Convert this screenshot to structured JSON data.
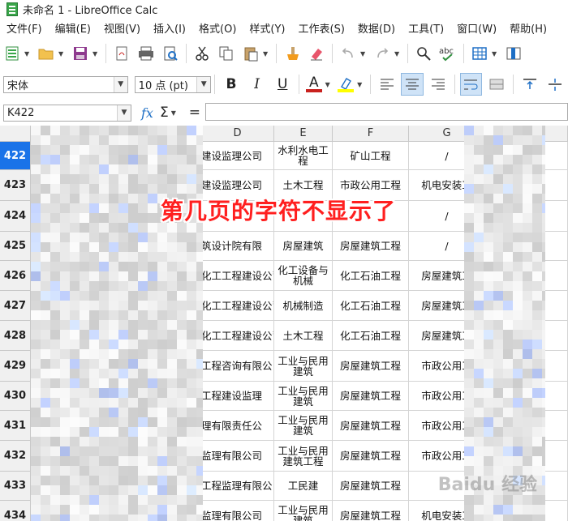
{
  "window": {
    "title": "未命名 1 - LibreOffice Calc"
  },
  "menu": [
    "文件(F)",
    "编辑(E)",
    "视图(V)",
    "插入(I)",
    "格式(O)",
    "样式(Y)",
    "工作表(S)",
    "数据(D)",
    "工具(T)",
    "窗口(W)",
    "帮助(H)"
  ],
  "toolbar": {
    "icons": [
      "new-spreadsheet-icon",
      "open-folder-icon",
      "save-icon",
      "export-pdf-icon",
      "print-icon",
      "print-preview-icon",
      "cut-icon",
      "copy-icon",
      "paste-icon",
      "clone-formatting-icon",
      "clear-formatting-icon",
      "undo-icon",
      "redo-icon",
      "find-replace-icon",
      "spelling-icon",
      "borders-icon",
      "column-icon"
    ]
  },
  "format_bar": {
    "font_name": "宋体",
    "font_size": "10 点 (pt)",
    "bold": "B",
    "italic": "I",
    "underline": "U",
    "font_color_letter": "A",
    "font_color": "#c9211e",
    "highlight_color": "#ffff00"
  },
  "formula_bar": {
    "name_box": "K422",
    "fx": "fx",
    "sigma": "Σ",
    "equals": "=",
    "content": ""
  },
  "grid": {
    "columns": [
      "D",
      "E",
      "F",
      "G"
    ],
    "selected_row": "422",
    "rows": [
      {
        "num": "422",
        "D": "建设监理公司",
        "E": "水利水电工程",
        "F": "矿山工程",
        "G": "/"
      },
      {
        "num": "423",
        "D": "建设监理公司",
        "E": "土木工程",
        "F": "市政公用工程",
        "G": "机电安装工"
      },
      {
        "num": "424",
        "D": "",
        "E": "",
        "F": "",
        "G": "/"
      },
      {
        "num": "425",
        "D": "筑设计院有限",
        "E": "房屋建筑",
        "F": "房屋建筑工程",
        "G": "/"
      },
      {
        "num": "426",
        "D": "化工工程建设公司",
        "E": "化工设备与机械",
        "F": "化工石油工程",
        "G": "房屋建筑工"
      },
      {
        "num": "427",
        "D": "化工工程建设公司",
        "E": "机械制造",
        "F": "化工石油工程",
        "G": "房屋建筑工"
      },
      {
        "num": "428",
        "D": "化工工程建设公司",
        "E": "土木工程",
        "F": "化工石油工程",
        "G": "房屋建筑工"
      },
      {
        "num": "429",
        "D": "工程咨询有限公",
        "E": "工业与民用建筑",
        "F": "房屋建筑工程",
        "G": "市政公用工"
      },
      {
        "num": "430",
        "D": "工程建设监理",
        "E": "工业与民用建筑",
        "F": "房屋建筑工程",
        "G": "市政公用工"
      },
      {
        "num": "431",
        "D": "理有限责任公",
        "E": "工业与民用建筑",
        "F": "房屋建筑工程",
        "G": "市政公用工"
      },
      {
        "num": "432",
        "D": "监理有限公司",
        "E": "工业与民用建筑工程",
        "F": "房屋建筑工程",
        "G": "市政公用工"
      },
      {
        "num": "433",
        "D": "工程监理有限公",
        "E": "工民建",
        "F": "房屋建筑工程",
        "G": ""
      },
      {
        "num": "434",
        "D": "监理有限公司",
        "E": "工业与民用建筑",
        "F": "房屋建筑工程",
        "G": "机电安装工"
      }
    ]
  },
  "annotation": "第几页的字符不显示了",
  "watermark": "Baidu 经验"
}
